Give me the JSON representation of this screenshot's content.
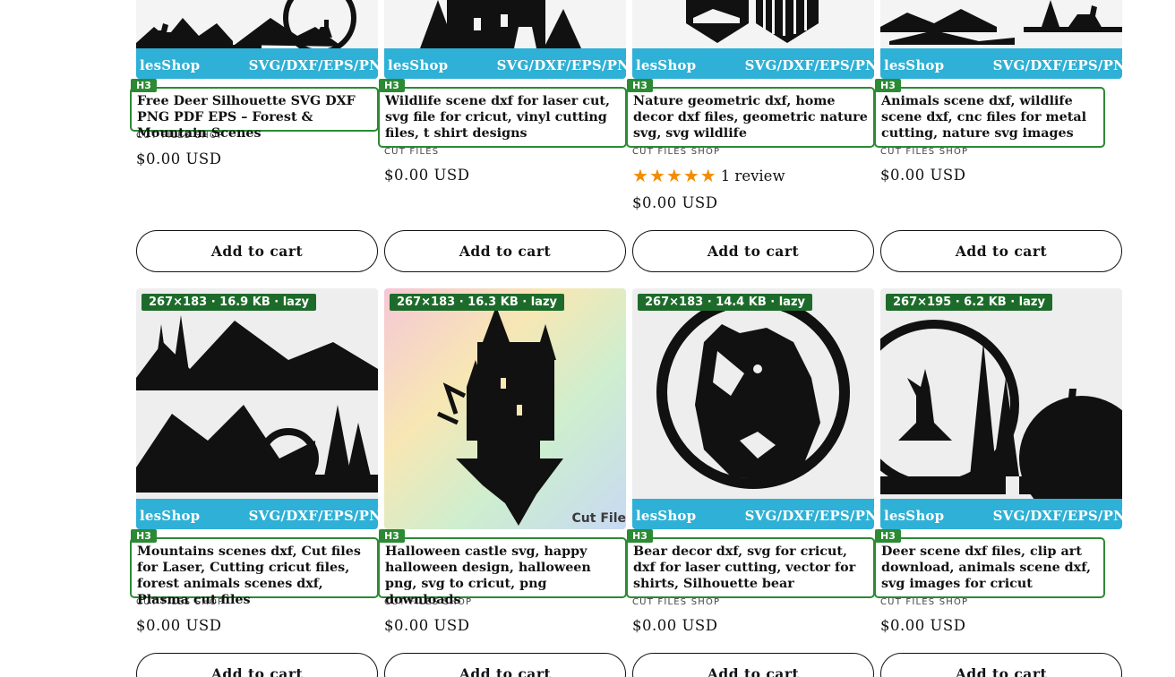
{
  "brand_strip": {
    "left_text": "lesShop",
    "right_text": "SVG/DXF/EPS/PN"
  },
  "heading_badge": "H3",
  "row1": [
    {
      "title": "Free Deer Silhouette SVG DXF PNG PDF EPS – Forest & Mountain Scenes",
      "vendor": "CUT FILES SHOP",
      "price": "$0.00 USD",
      "button": "Add to cart",
      "image_icon": "deer-forest-illustration"
    },
    {
      "title": "Wildlife scene dxf for laser cut, svg file for cricut, vinyl cutting files, t shirt designs",
      "vendor": "CUT FILES",
      "price": "$0.00 USD",
      "button": "Add to cart",
      "image_icon": "castle-silhouette-illustration"
    },
    {
      "title": "Nature geometric dxf, home decor dxf files, geometric nature svg, svg wildlife",
      "vendor": "CUT FILES SHOP",
      "rating_stars": 5,
      "review_text": "1 review",
      "price": "$0.00 USD",
      "button": "Add to cart",
      "image_icon": "geometric-shield-illustration"
    },
    {
      "title": "Animals scene dxf, wildlife scene dxf, cnc files for metal cutting, nature svg images",
      "vendor": "CUT FILES SHOP",
      "price": "$0.00 USD",
      "button": "Add to cart",
      "image_icon": "mountain-deer-illustration"
    }
  ],
  "row2": [
    {
      "perf": "267×183 · 16.9 KB · lazy",
      "title": "Mountains scenes dxf, Cut files for Laser, Cutting cricut files, forest animals scenes dxf, Plasma cut files",
      "vendor": "CUT FILES SHOP",
      "price": "$0.00 USD",
      "button": "Add to cart",
      "image_icon": "mountain-scenes-illustration"
    },
    {
      "perf": "267×183 · 16.3 KB · lazy",
      "title": "Halloween castle svg, happy halloween design, halloween png, svg to cricut, png downloads",
      "vendor": "CUT FILES SHOP",
      "price": "$0.00 USD",
      "button": "Add to cart",
      "watermark": "Cut File",
      "image_icon": "halloween-castle-illustration"
    },
    {
      "perf": "267×183 · 14.4 KB · lazy",
      "title": "Bear decor dxf, svg for cricut, dxf for laser cutting, vector for shirts, Silhouette bear",
      "vendor": "CUT FILES SHOP",
      "price": "$0.00 USD",
      "button": "Add to cart",
      "image_icon": "bear-head-illustration"
    },
    {
      "perf": "267×195 · 6.2 KB · lazy",
      "title": "Deer scene dxf files, clip art download, animals scene dxf, svg images for cricut",
      "vendor": "CUT FILES SHOP",
      "price": "$0.00 USD",
      "button": "Add to cart",
      "image_icon": "deer-scene-illustration"
    }
  ],
  "colors": {
    "strip_blue": "#2fb0d6",
    "heading_green": "#2c8a34",
    "perf_badge_green": "#1d6b2a",
    "star_orange": "#f28c00"
  }
}
